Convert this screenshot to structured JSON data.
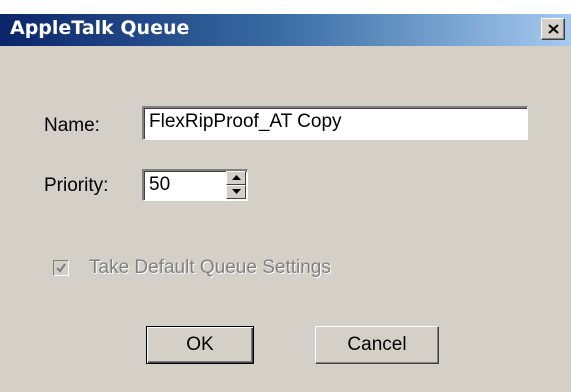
{
  "window": {
    "title": "AppleTalk Queue",
    "close_icon": "close-icon"
  },
  "form": {
    "name_label": "Name:",
    "name_value": "FlexRipProof_AT Copy",
    "priority_label": "Priority:",
    "priority_value": "50",
    "spinner_icons": [
      "spin-up-icon",
      "spin-down-icon"
    ],
    "checkbox_label": "Take Default Queue Settings",
    "checkbox_checked": true,
    "checkbox_enabled": false
  },
  "buttons": {
    "ok_label": "OK",
    "cancel_label": "Cancel"
  },
  "colors": {
    "face": "#d4d0c8",
    "title_start": "#0a246a",
    "title_end": "#a6caf0",
    "disabled_text": "#808080"
  }
}
